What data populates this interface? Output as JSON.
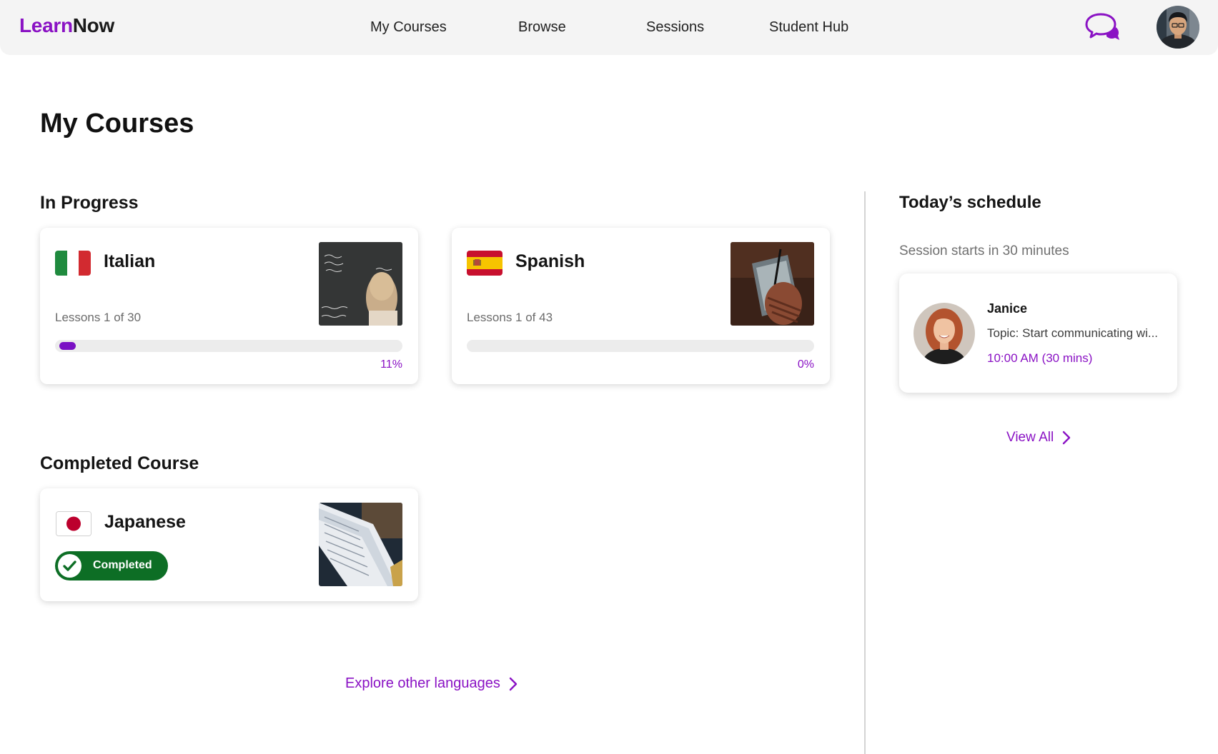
{
  "brand": {
    "part1": "Learn",
    "part2": "Now",
    "accent": "#8a12c4"
  },
  "nav": [
    {
      "label": "My Courses"
    },
    {
      "label": "Browse"
    },
    {
      "label": "Sessions"
    },
    {
      "label": "Student Hub"
    }
  ],
  "header_icons": {
    "chat": "chat-bubbles-icon",
    "avatar": "user-avatar"
  },
  "page_title": "My Courses",
  "in_progress": {
    "title": "In Progress",
    "courses": [
      {
        "name": "Italian",
        "flag": "italy-flag-icon",
        "lessons": "Lessons 1 of 30",
        "progress_pct": 11,
        "progress_label": "11%",
        "image": "chalkboard-photo"
      },
      {
        "name": "Spanish",
        "flag": "spain-flag-icon",
        "lessons": "Lessons 1 of 43",
        "progress_pct": 0,
        "progress_label": "0%",
        "image": "tablet-writing-photo"
      }
    ]
  },
  "completed": {
    "title": "Completed Course",
    "courses": [
      {
        "name": "Japanese",
        "flag": "japan-flag-icon",
        "status": "Completed",
        "status_color": "#0d6e25",
        "image": "open-book-photo"
      }
    ]
  },
  "explore_link": "Explore other languages",
  "schedule": {
    "title": "Today’s schedule",
    "subtitle": "Session starts in 30 minutes",
    "session": {
      "tutor": "Janice",
      "topic": "Topic: Start communicating wi...",
      "time": "10:00 AM (30 mins)"
    },
    "view_all": "View All"
  }
}
